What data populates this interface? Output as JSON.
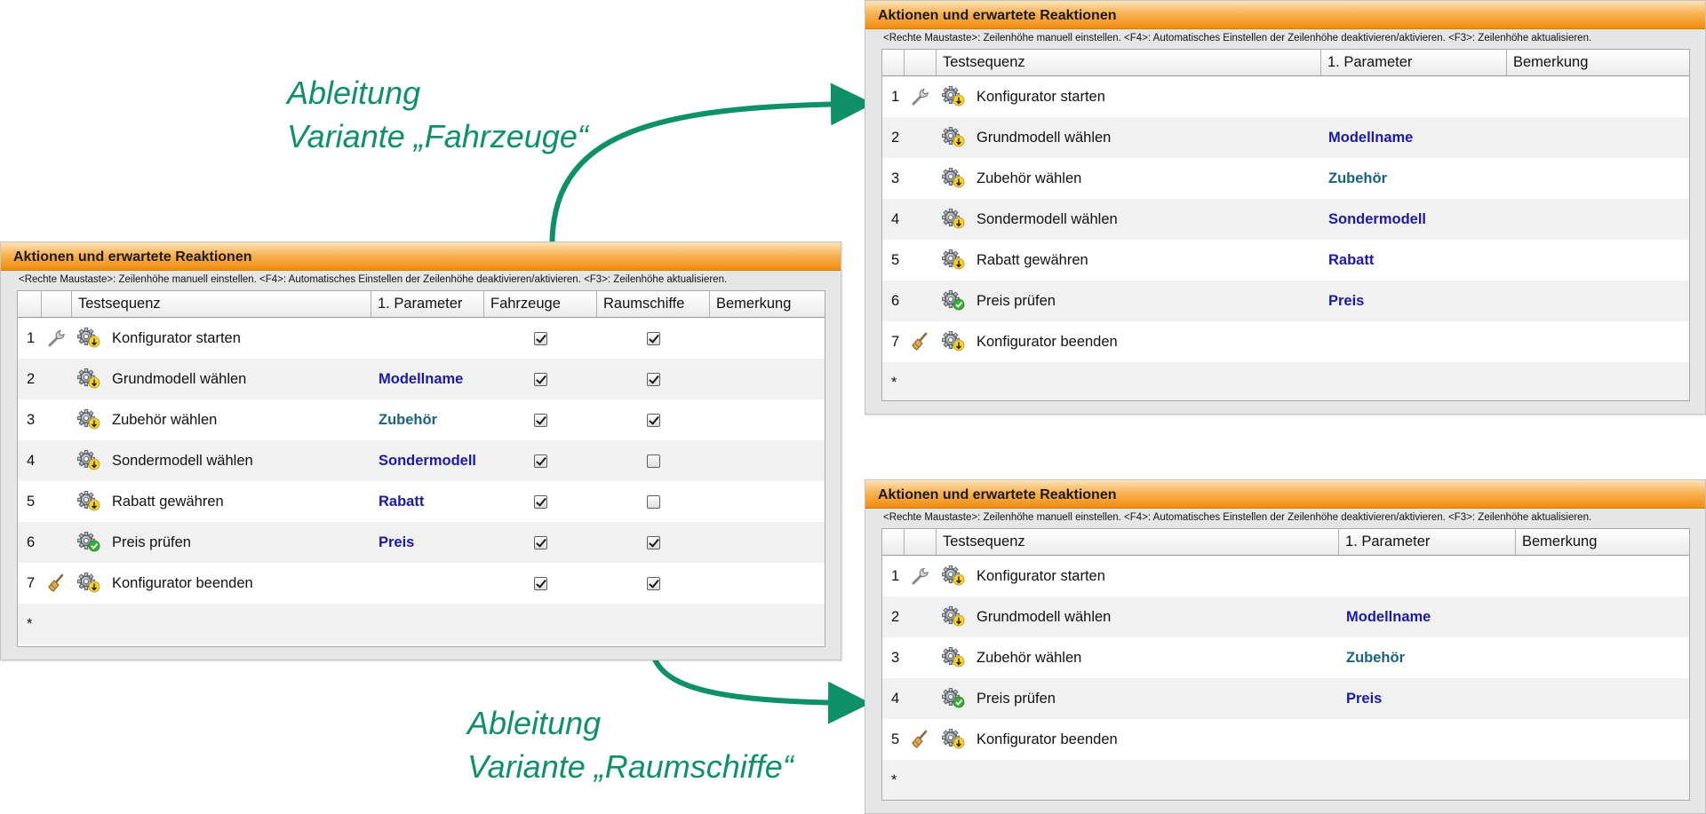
{
  "panel_title": "Aktionen und erwartete Reaktionen",
  "hint": "<Rechte Maustaste>: Zeilenhöhe manuell einstellen. <F4>: Automatisches Einstellen der Zeilenhöhe deaktivieren/aktivieren. <F3>: Zeilenhöhe aktualisieren.",
  "headers": {
    "seq": "Testsequenz",
    "param": "1. Parameter",
    "fahrzeuge": "Fahrzeuge",
    "raumschiffe": "Raumschiffe",
    "bemerkung": "Bemerkung"
  },
  "new_row_marker": "*",
  "main_rows": [
    {
      "num": "1",
      "tool": "wrench-icon",
      "icon": "gear-start-icon",
      "seq": "Konfigurator starten",
      "param": "",
      "param_color": "",
      "fahrzeuge": true,
      "raumschiffe": true
    },
    {
      "num": "2",
      "tool": "",
      "icon": "gear-start-icon",
      "seq": "Grundmodell wählen",
      "param": "Modellname",
      "param_color": "blue",
      "fahrzeuge": true,
      "raumschiffe": true
    },
    {
      "num": "3",
      "tool": "",
      "icon": "gear-start-icon",
      "seq": "Zubehör wählen",
      "param": "Zubehör",
      "param_color": "teal",
      "fahrzeuge": true,
      "raumschiffe": true
    },
    {
      "num": "4",
      "tool": "",
      "icon": "gear-start-icon",
      "seq": "Sondermodell wählen",
      "param": "Sondermodell",
      "param_color": "blue",
      "fahrzeuge": true,
      "raumschiffe": false
    },
    {
      "num": "5",
      "tool": "",
      "icon": "gear-start-icon",
      "seq": "Rabatt gewähren",
      "param": "Rabatt",
      "param_color": "blue",
      "fahrzeuge": true,
      "raumschiffe": false
    },
    {
      "num": "6",
      "tool": "",
      "icon": "gear-check-icon",
      "seq": "Preis prüfen",
      "param": "Preis",
      "param_color": "blue",
      "fahrzeuge": true,
      "raumschiffe": true
    },
    {
      "num": "7",
      "tool": "broom-icon",
      "icon": "gear-start-icon",
      "seq": "Konfigurator beenden",
      "param": "",
      "param_color": "",
      "fahrzeuge": true,
      "raumschiffe": true
    }
  ],
  "fahrzeuge_rows": [
    {
      "num": "1",
      "tool": "wrench-icon",
      "icon": "gear-start-icon",
      "seq": "Konfigurator starten",
      "param": "",
      "param_color": ""
    },
    {
      "num": "2",
      "tool": "",
      "icon": "gear-start-icon",
      "seq": "Grundmodell wählen",
      "param": "Modellname",
      "param_color": "blue"
    },
    {
      "num": "3",
      "tool": "",
      "icon": "gear-start-icon",
      "seq": "Zubehör wählen",
      "param": "Zubehör",
      "param_color": "teal"
    },
    {
      "num": "4",
      "tool": "",
      "icon": "gear-start-icon",
      "seq": "Sondermodell wählen",
      "param": "Sondermodell",
      "param_color": "blue"
    },
    {
      "num": "5",
      "tool": "",
      "icon": "gear-start-icon",
      "seq": "Rabatt gewähren",
      "param": "Rabatt",
      "param_color": "blue"
    },
    {
      "num": "6",
      "tool": "",
      "icon": "gear-check-icon",
      "seq": "Preis prüfen",
      "param": "Preis",
      "param_color": "blue"
    },
    {
      "num": "7",
      "tool": "broom-icon",
      "icon": "gear-start-icon",
      "seq": "Konfigurator beenden",
      "param": "",
      "param_color": ""
    }
  ],
  "raumschiffe_rows": [
    {
      "num": "1",
      "tool": "wrench-icon",
      "icon": "gear-start-icon",
      "seq": "Konfigurator starten",
      "param": "",
      "param_color": ""
    },
    {
      "num": "2",
      "tool": "",
      "icon": "gear-start-icon",
      "seq": "Grundmodell wählen",
      "param": "Modellname",
      "param_color": "blue"
    },
    {
      "num": "3",
      "tool": "",
      "icon": "gear-start-icon",
      "seq": "Zubehör wählen",
      "param": "Zubehör",
      "param_color": "teal"
    },
    {
      "num": "4",
      "tool": "",
      "icon": "gear-check-icon",
      "seq": "Preis prüfen",
      "param": "Preis",
      "param_color": "blue"
    },
    {
      "num": "5",
      "tool": "broom-icon",
      "icon": "gear-start-icon",
      "seq": "Konfigurator beenden",
      "param": "",
      "param_color": ""
    }
  ],
  "captions": {
    "fahrzeuge_line1": "Ableitung",
    "fahrzeuge_line2": "Variante „Fahrzeuge“",
    "raumschiffe_line1": "Ableitung",
    "raumschiffe_line2": "Variante „Raumschiffe“"
  },
  "colors": {
    "title_bar": "#f9b356",
    "param_blue": "#1a1aa8",
    "param_teal": "#1a6280",
    "arrow": "#0e9068"
  }
}
